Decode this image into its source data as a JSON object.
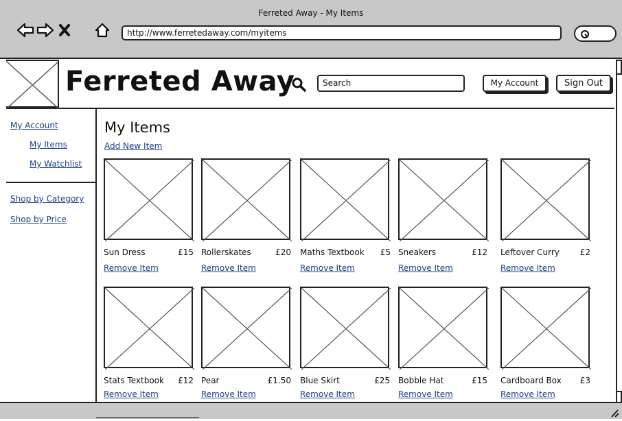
{
  "window": {
    "title": "Ferreted Away - My Items"
  },
  "browser": {
    "url": "http://www.ferretedaway.com/myitems",
    "icons": [
      "back-arrow-icon",
      "forward-arrow-icon",
      "close-icon",
      "home-icon",
      "search-icon"
    ]
  },
  "header": {
    "site_title": "Ferreted Away",
    "search_placeholder": "Search",
    "my_account_label": "My Account",
    "sign_out_label": "Sign Out"
  },
  "sidebar": {
    "my_account": "My Account",
    "my_items": "My Items",
    "my_watchlist": "My Watchlist",
    "shop_by_category": "Shop by Category",
    "shop_by_price": "Shop by Price"
  },
  "main": {
    "title": "My Items",
    "add_new_item": "Add New Item",
    "remove_label": "Remove Item",
    "items": [
      {
        "name": "Sun Dress",
        "price": "£15"
      },
      {
        "name": "Rollerskates",
        "price": "£20"
      },
      {
        "name": "Maths Textbook",
        "price": "£5"
      },
      {
        "name": "Sneakers",
        "price": "£12"
      },
      {
        "name": "Leftover Curry",
        "price": "£2"
      },
      {
        "name": "Stats Textbook",
        "price": "£12"
      },
      {
        "name": "Pear",
        "price": "£1.50"
      },
      {
        "name": "Blue Skirt",
        "price": "£25"
      },
      {
        "name": "Bobble Hat",
        "price": "£15"
      },
      {
        "name": "Cardboard Box",
        "price": "£3"
      }
    ]
  },
  "colors": {
    "link": "#1a3f8a",
    "chrome": "#c8c8c8",
    "border": "#222222"
  }
}
